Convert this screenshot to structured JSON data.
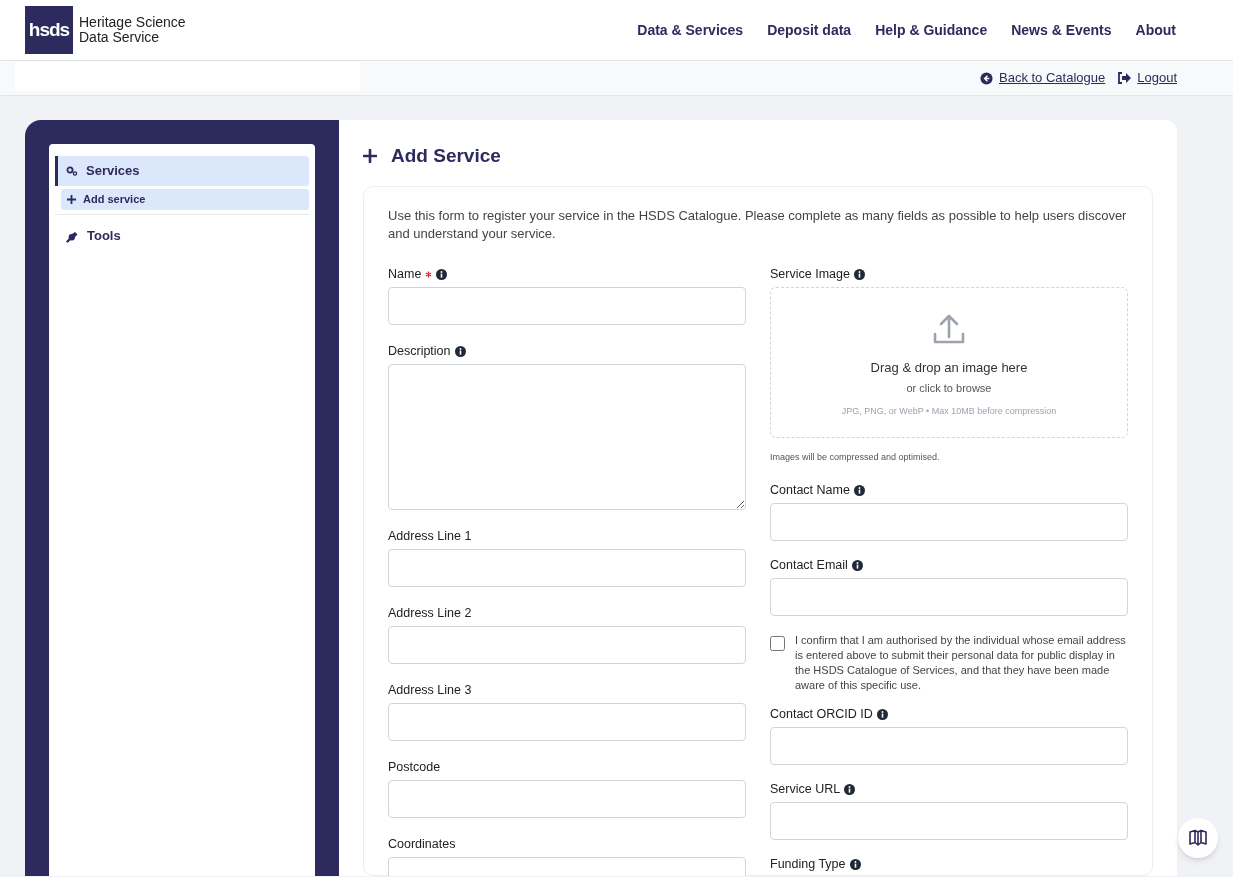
{
  "header": {
    "logo_mark": "hsds",
    "logo_line1": "Heritage Science",
    "logo_line2": "Data Service",
    "nav": [
      {
        "label": "Data & Services"
      },
      {
        "label": "Deposit data"
      },
      {
        "label": "Help & Guidance"
      },
      {
        "label": "News & Events"
      },
      {
        "label": "About"
      }
    ]
  },
  "subbar": {
    "links": [
      {
        "label": "Back to Catalogue",
        "kind": "back"
      },
      {
        "label": "Logout",
        "kind": "logout"
      }
    ]
  },
  "sidebar": {
    "items": [
      {
        "label": "Services",
        "kind": "gears",
        "selected": true,
        "children": [
          {
            "label": "Add service",
            "kind": "plus",
            "selected": true
          }
        ]
      },
      {
        "label": "Tools",
        "kind": "wrench",
        "selected": false
      }
    ]
  },
  "page": {
    "title": "Add Service",
    "intro": "Use this form to register your service in the HSDS Catalogue. Please complete as many fields as possible to help users discover and understand your service."
  },
  "form": {
    "left": [
      {
        "kind": "input",
        "label": "Name",
        "required": true,
        "info": true
      },
      {
        "kind": "textarea",
        "label": "Description",
        "required": false,
        "info": true
      },
      {
        "kind": "input",
        "label": "Address Line 1",
        "required": false,
        "info": false
      },
      {
        "kind": "input",
        "label": "Address Line 2",
        "required": false,
        "info": false
      },
      {
        "kind": "input",
        "label": "Address Line 3",
        "required": false,
        "info": false
      },
      {
        "kind": "input",
        "label": "Postcode",
        "required": false,
        "info": false
      },
      {
        "kind": "input",
        "label": "Coordinates",
        "required": false,
        "info": false
      }
    ],
    "right": [
      {
        "kind": "dropzone",
        "label": "Service Image",
        "required": false,
        "info": true,
        "title": "Drag & drop an image here",
        "subtitle": "or click to browse",
        "hint": "JPG, PNG, or WebP • Max 10MB before compression",
        "note": "Images will be compressed and optimised."
      },
      {
        "kind": "input",
        "label": "Contact Name",
        "required": false,
        "info": true
      },
      {
        "kind": "input",
        "label": "Contact Email",
        "required": false,
        "info": true
      },
      {
        "kind": "checkbox",
        "label": "I confirm that I am authorised by the individual whose email address is entered above to submit their personal data for public display in the HSDS Catalogue of Services, and that they have been made aware of this specific use.",
        "checked": false
      },
      {
        "kind": "input",
        "label": "Contact ORCID ID",
        "required": false,
        "info": true
      },
      {
        "kind": "input",
        "label": "Service URL",
        "required": false,
        "info": true
      },
      {
        "kind": "label_only",
        "label": "Funding Type",
        "required": false,
        "info": true
      }
    ]
  }
}
